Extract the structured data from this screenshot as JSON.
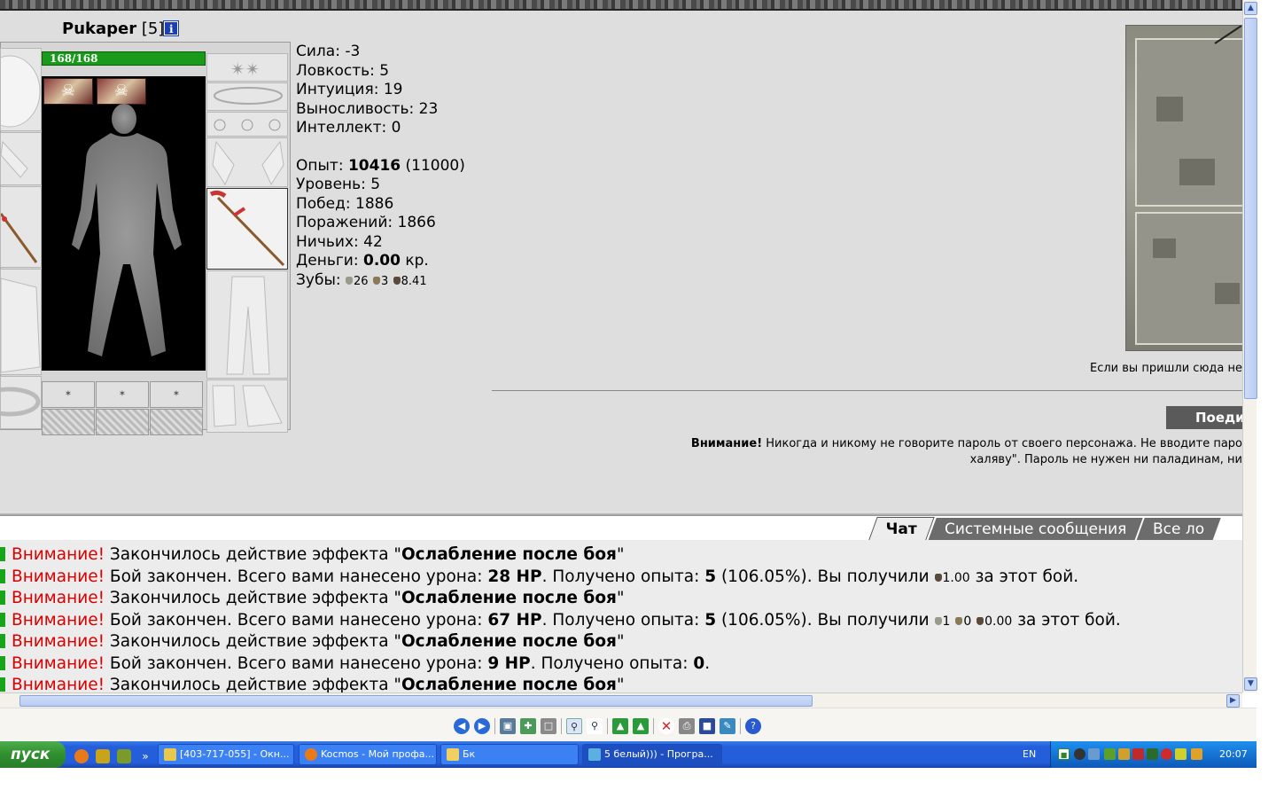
{
  "character": {
    "name": "Pukaper",
    "level": "[5]",
    "hp": "168/168"
  },
  "stats": {
    "strength": "Сила: -3",
    "agility": "Ловкость: 5",
    "intuition": "Интуиция: 19",
    "endurance": "Выносливость: 23",
    "intellect": "Интеллект: 0",
    "exp_label": "Опыт:",
    "exp_value": "10416",
    "exp_next": "(11000)",
    "level_line": "Уровень: 5",
    "wins": "Побед: 1886",
    "losses": "Поражений: 1866",
    "draws": "Ничьих: 42",
    "money_label": "Деньги:",
    "money_value": "0.00",
    "money_unit": "кр.",
    "teeth_label": "Зубы:",
    "teeth_1": "26",
    "teeth_2": "3",
    "teeth_3": "8.41"
  },
  "right": {
    "note": "Если вы пришли сюда не",
    "enter_button": "Поеди",
    "warning_bold": "Внимание!",
    "warning_line1": "Никогда и никому не говорите пароль от своего персонажа. Не вводите паро",
    "warning_line2": "халяву\". Пароль не нужен ни паладинам, ни"
  },
  "chat_tabs": [
    "Чат",
    "Системные сообщения",
    "Все ло"
  ],
  "chat": {
    "warn": "Внимание!",
    "messages": [
      {
        "pre": "Закончилось действие эффекта \"",
        "bold": "Ослабление после боя",
        "post": "\""
      },
      {
        "pre": "Бой закончен. Всего вами нанесено урона: ",
        "bold": "28 HP",
        "post": ". Получено опыта: ",
        "bold2": "5",
        "post2": " (106.05%). Вы получили ",
        "tooth": "1.00",
        "post3": " за этот бой."
      },
      {
        "pre": "Закончилось действие эффекта \"",
        "bold": "Ослабление после боя",
        "post": "\""
      },
      {
        "pre": "Бой закончен. Всего вами нанесено урона: ",
        "bold": "67 HP",
        "post": ". Получено опыта: ",
        "bold2": "5",
        "post2": " (106.05%). Вы получили ",
        "t1": "1",
        "t2": "0",
        "t3": "0.00",
        "post3": " за этот бой."
      },
      {
        "pre": "Закончилось действие эффекта \"",
        "bold": "Ослабление после боя",
        "post": "\""
      },
      {
        "pre": "Бой закончен. Всего вами нанесено урона: ",
        "bold": "9 HP",
        "post": ". Получено опыта: ",
        "bold2": "0",
        "post2": "."
      },
      {
        "pre": "Закончилось действие эффекта \"",
        "bold": "Ослабление после боя",
        "post": "\""
      }
    ]
  },
  "taskbar": {
    "start": "пуск",
    "tasks": [
      "[403-717-055] - Окн...",
      "Kocmos - Мой профа...",
      "Бк",
      "5 белый))) - Програ..."
    ],
    "lang": "EN",
    "clock": "20:07"
  },
  "icons": {
    "info": "info-icon",
    "colors": {
      "hp": "#1a9a1a",
      "warn": "#d90000",
      "taskbar": "#245edb",
      "start": "#2f8f2f"
    }
  }
}
